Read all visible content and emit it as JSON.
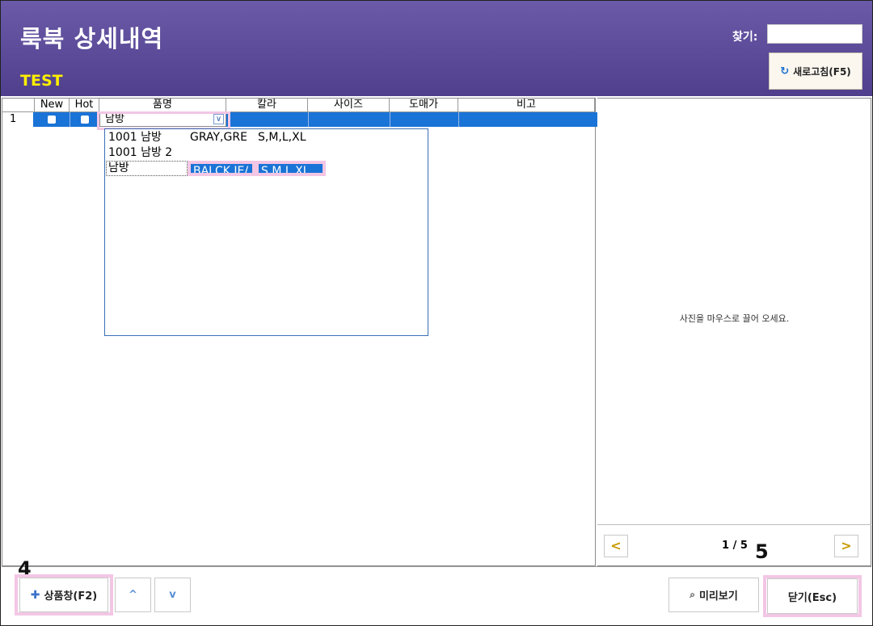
{
  "header": {
    "title": "룩북 상세내역",
    "subtitle": "TEST",
    "find_label": "찾기:",
    "find_value": "",
    "refresh_label": "새로고침(F5)"
  },
  "grid": {
    "columns": [
      "New",
      "Hot",
      "품명",
      "칼라",
      "사이즈",
      "도매가",
      "비고"
    ],
    "row": {
      "number": "1",
      "product": "남방"
    },
    "dropdown": [
      {
        "name": "1001 남방",
        "color": "GRAY,GRE",
        "size": "S,M,L,XL"
      },
      {
        "name": "1001 남방 2",
        "color": "",
        "size": ""
      },
      {
        "name": "남방",
        "color": "BALCK,JE/",
        "size": "S,M,L,XL"
      }
    ]
  },
  "preview": {
    "drop_message": "사진을 마우스로 끌어 오세요.",
    "page_label": "1 / 5",
    "prev": "<",
    "next": ">"
  },
  "footer": {
    "product_window_label": "상품창(F2)",
    "up": "^",
    "down": "v",
    "preview_label": "미리보기",
    "close_label": "닫기(Esc)",
    "badge_4": "4",
    "badge_5": "5"
  },
  "colors": {
    "header_top": "#6b5aa8",
    "header_bottom": "#4f3f8c",
    "subtitle": "#ffef00",
    "selection": "#1a73d6",
    "highlight": "#f3c6e4",
    "pager_arrow": "#c89a00"
  }
}
